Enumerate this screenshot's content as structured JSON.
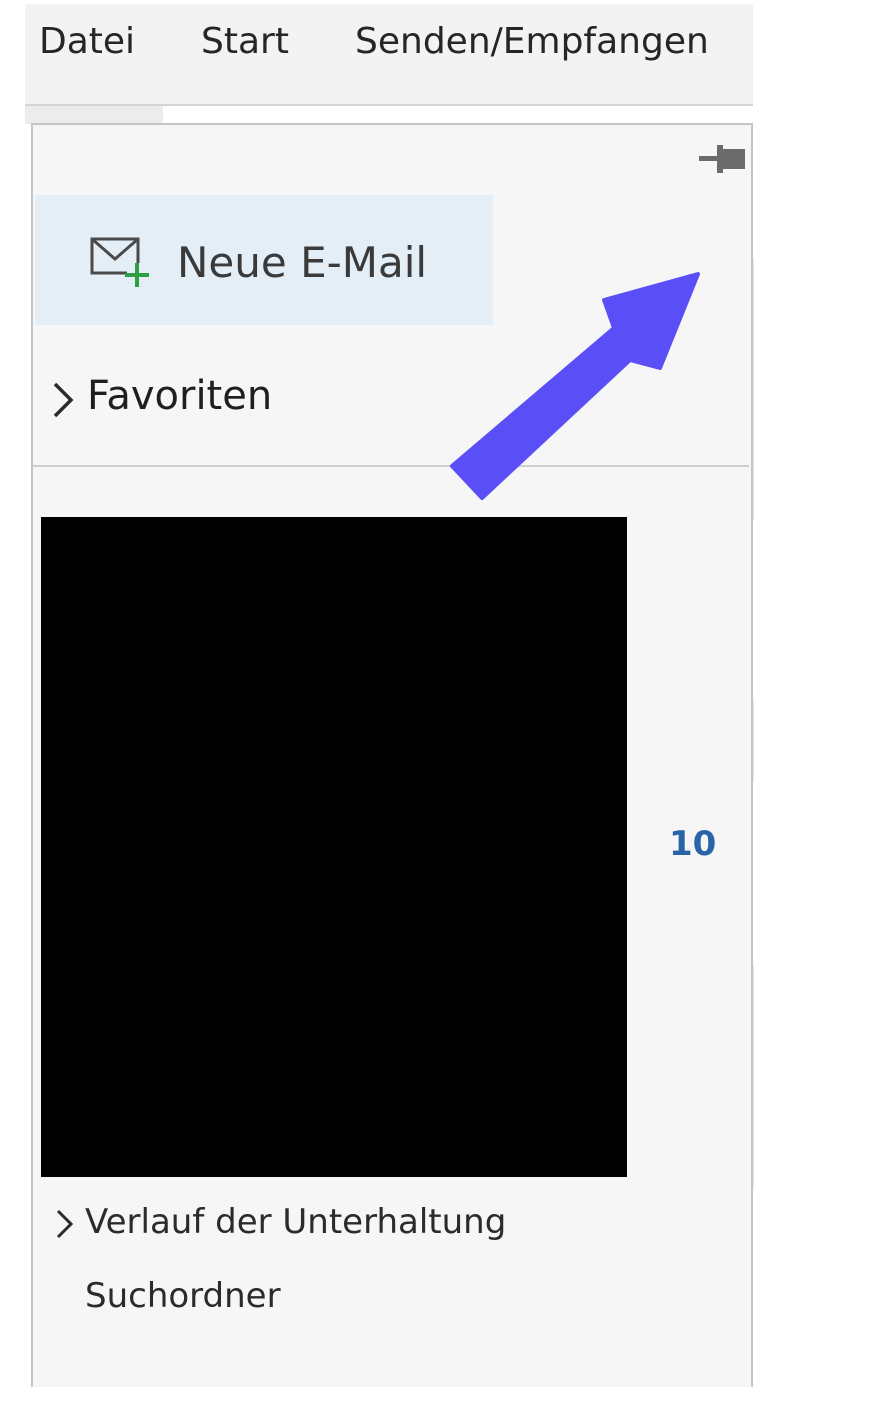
{
  "ribbon": {
    "tabs": [
      {
        "label": "Datei"
      },
      {
        "label": "Start"
      },
      {
        "label": "Senden/Empfangen"
      }
    ]
  },
  "pane": {
    "new_mail_label": "Neue E-Mail",
    "favorites_label": "Favoriten",
    "unread_count": "10",
    "history_label": "Verlauf der Unterhaltung",
    "search_folder_label": "Suchordner"
  },
  "icons": {
    "pin": "pin-icon",
    "new_mail": "new-mail-icon",
    "chevron": "chevron-right-icon"
  },
  "colors": {
    "new_mail_background": "#e3eef7",
    "unread_count": "#2a64a8",
    "annotation_arrow": "#5a4ff7",
    "plus_sign": "#2ea043"
  }
}
